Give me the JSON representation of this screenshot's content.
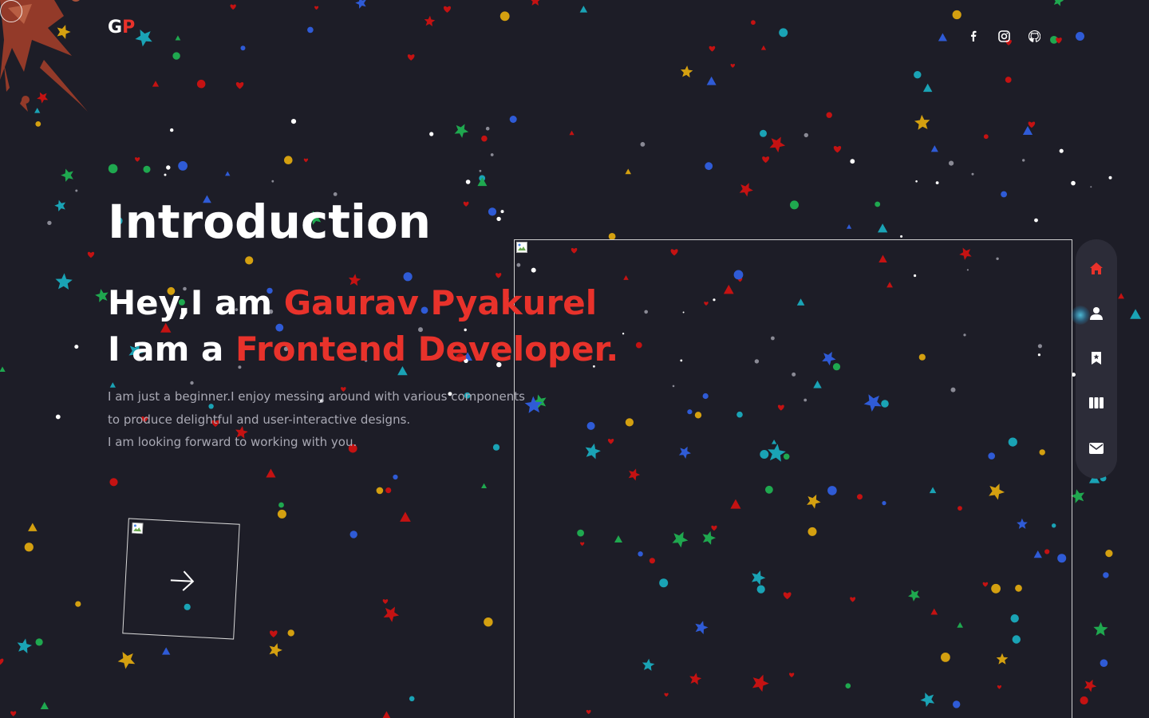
{
  "brand": {
    "logo_first": "G",
    "logo_second": "P"
  },
  "socials": [
    {
      "name": "facebook",
      "icon": "facebook-icon"
    },
    {
      "name": "instagram",
      "icon": "instagram-icon"
    },
    {
      "name": "github",
      "icon": "github-icon"
    }
  ],
  "hero": {
    "title": "Introduction",
    "line1_prefix": "Hey,I am ",
    "line1_name": "Gaurav Pyakurel",
    "line2_prefix": "I am a ",
    "line2_role": "Frontend Developer.",
    "description": [
      "I am just a beginner.I enjoy messing around with various components",
      "to produce delightful and user-interactive designs.",
      "I am looking forward to working with you."
    ]
  },
  "side_nav": [
    {
      "name": "home",
      "icon": "home-icon",
      "active": true
    },
    {
      "name": "about",
      "icon": "user-icon",
      "active": false
    },
    {
      "name": "services",
      "icon": "bookmark-icon",
      "active": false
    },
    {
      "name": "portfolio",
      "icon": "columns-icon",
      "active": false
    },
    {
      "name": "contact",
      "icon": "envelope-icon",
      "active": false
    }
  ],
  "colors": {
    "background": "#1d1d27",
    "accent": "#e8322b",
    "text": "#ffffff",
    "muted": "#a9a9b4",
    "nav_bg": "#2c2c38",
    "confetti": [
      "#c41212",
      "#1fa84f",
      "#2f5bd6",
      "#d4a010",
      "#1aa3b5"
    ]
  }
}
